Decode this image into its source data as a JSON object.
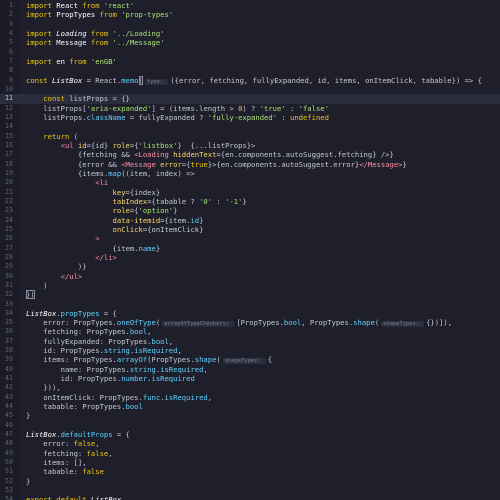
{
  "editor": {
    "active_line": 10,
    "lines": [
      {
        "n": "1",
        "tokens": [
          {
            "t": "import",
            "c": "kw"
          },
          {
            "t": " React ",
            "c": "id"
          },
          {
            "t": "from",
            "c": "kw"
          },
          {
            "t": " 'react'",
            "c": "str"
          }
        ]
      },
      {
        "n": "2",
        "tokens": [
          {
            "t": "import",
            "c": "kw"
          },
          {
            "t": " PropTypes ",
            "c": "id"
          },
          {
            "t": "from",
            "c": "kw"
          },
          {
            "t": " 'prop-types'",
            "c": "str"
          }
        ]
      },
      {
        "n": "3",
        "tokens": []
      },
      {
        "n": "4",
        "tokens": [
          {
            "t": "import",
            "c": "kw"
          },
          {
            "t": " Loading ",
            "c": "id it"
          },
          {
            "t": "from",
            "c": "kw"
          },
          {
            "t": " '../Loading'",
            "c": "str"
          }
        ]
      },
      {
        "n": "5",
        "tokens": [
          {
            "t": "import",
            "c": "kw"
          },
          {
            "t": " Message ",
            "c": "id"
          },
          {
            "t": "from",
            "c": "kw"
          },
          {
            "t": " '../Message'",
            "c": "str"
          }
        ]
      },
      {
        "n": "6",
        "tokens": []
      },
      {
        "n": "7",
        "tokens": [
          {
            "t": "import",
            "c": "kw"
          },
          {
            "t": " en ",
            "c": "id"
          },
          {
            "t": "from",
            "c": "kw"
          },
          {
            "t": " 'enGB'",
            "c": "str"
          }
        ]
      },
      {
        "n": "8",
        "tokens": []
      },
      {
        "n": "9",
        "tokens": [
          {
            "t": "const",
            "c": "kw"
          },
          {
            "t": " ListBox",
            "c": "id it"
          },
          {
            "t": " = React.",
            "c": "pun"
          },
          {
            "t": "memo",
            "c": "prop"
          },
          {
            "t": "(",
            "c": "pun cur"
          },
          {
            "t": "type: ",
            "c": "hint"
          },
          {
            "t": "({error, fetching, fullyExpanded, id, items, onItemClick, tabable}) => {",
            "c": "pun"
          }
        ]
      },
      {
        "n": "10",
        "tokens": []
      },
      {
        "n": "11",
        "tokens": [
          {
            "t": "    const",
            "c": "kw"
          },
          {
            "t": " listProps = {}",
            "c": "pun"
          }
        ]
      },
      {
        "n": "12",
        "tokens": [
          {
            "t": "    listProps[",
            "c": "pun"
          },
          {
            "t": "'aria-expanded'",
            "c": "str"
          },
          {
            "t": "] = (items.length > ",
            "c": "pun"
          },
          {
            "t": "0",
            "c": "num"
          },
          {
            "t": ") ? ",
            "c": "pun"
          },
          {
            "t": "'true'",
            "c": "str"
          },
          {
            "t": " : ",
            "c": "pun"
          },
          {
            "t": "'false'",
            "c": "str"
          }
        ]
      },
      {
        "n": "13",
        "tokens": [
          {
            "t": "    listProps.",
            "c": "pun"
          },
          {
            "t": "className",
            "c": "prop"
          },
          {
            "t": " = fullyExpanded ? ",
            "c": "pun"
          },
          {
            "t": "'fully-expanded'",
            "c": "str"
          },
          {
            "t": " : ",
            "c": "pun"
          },
          {
            "t": "undefined",
            "c": "kw"
          }
        ]
      },
      {
        "n": "14",
        "tokens": []
      },
      {
        "n": "15",
        "tokens": [
          {
            "t": "    return",
            "c": "kw"
          },
          {
            "t": " (",
            "c": "pun"
          }
        ]
      },
      {
        "n": "16",
        "tokens": [
          {
            "t": "        <ul ",
            "c": "tag"
          },
          {
            "t": "id",
            "c": "attr"
          },
          {
            "t": "={id} ",
            "c": "pun"
          },
          {
            "t": "role",
            "c": "attr"
          },
          {
            "t": "={",
            "c": "pun"
          },
          {
            "t": "'listbox'",
            "c": "str"
          },
          {
            "t": "}  {...listProps}>",
            "c": "pun"
          }
        ]
      },
      {
        "n": "17",
        "tokens": [
          {
            "t": "            {fetching && ",
            "c": "pun"
          },
          {
            "t": "<Loading ",
            "c": "tag"
          },
          {
            "t": "hiddenText",
            "c": "attr"
          },
          {
            "t": "={en.components.autoSuggest.fetching} />}",
            "c": "pun"
          }
        ]
      },
      {
        "n": "18",
        "tokens": [
          {
            "t": "            {error && ",
            "c": "pun"
          },
          {
            "t": "<Message ",
            "c": "tag"
          },
          {
            "t": "error",
            "c": "attr"
          },
          {
            "t": "={",
            "c": "pun"
          },
          {
            "t": "true",
            "c": "kw"
          },
          {
            "t": "}>{en.components.autoSuggest.error}",
            "c": "pun"
          },
          {
            "t": "</Message>",
            "c": "tag"
          },
          {
            "t": "}",
            "c": "pun"
          }
        ]
      },
      {
        "n": "19",
        "tokens": [
          {
            "t": "            {items.",
            "c": "pun"
          },
          {
            "t": "map",
            "c": "prop"
          },
          {
            "t": "((item, index) =>",
            "c": "pun"
          }
        ]
      },
      {
        "n": "20",
        "tokens": [
          {
            "t": "                <li",
            "c": "tag"
          }
        ]
      },
      {
        "n": "21",
        "tokens": [
          {
            "t": "                    key",
            "c": "attr"
          },
          {
            "t": "={index}",
            "c": "pun"
          }
        ]
      },
      {
        "n": "22",
        "tokens": [
          {
            "t": "                    tabIndex",
            "c": "attr"
          },
          {
            "t": "={tabable ? ",
            "c": "pun"
          },
          {
            "t": "'0'",
            "c": "str"
          },
          {
            "t": " : ",
            "c": "pun"
          },
          {
            "t": "'-1'",
            "c": "str"
          },
          {
            "t": "}",
            "c": "pun"
          }
        ]
      },
      {
        "n": "23",
        "tokens": [
          {
            "t": "                    role",
            "c": "attr"
          },
          {
            "t": "={",
            "c": "pun"
          },
          {
            "t": "'option'",
            "c": "str"
          },
          {
            "t": "}",
            "c": "pun"
          }
        ]
      },
      {
        "n": "24",
        "tokens": [
          {
            "t": "                    data-itemid",
            "c": "attr"
          },
          {
            "t": "={item.",
            "c": "pun"
          },
          {
            "t": "id",
            "c": "prop"
          },
          {
            "t": "}",
            "c": "pun"
          }
        ]
      },
      {
        "n": "25",
        "tokens": [
          {
            "t": "                    onClick",
            "c": "attr"
          },
          {
            "t": "={onItemClick}",
            "c": "pun"
          }
        ]
      },
      {
        "n": "26",
        "tokens": [
          {
            "t": "                >",
            "c": "tag"
          }
        ]
      },
      {
        "n": "27",
        "tokens": [
          {
            "t": "                    {item.",
            "c": "pun"
          },
          {
            "t": "name",
            "c": "prop"
          },
          {
            "t": "}",
            "c": "pun"
          }
        ]
      },
      {
        "n": "28",
        "tokens": [
          {
            "t": "                ",
            "c": "pun"
          },
          {
            "t": "</li>",
            "c": "tag"
          }
        ]
      },
      {
        "n": "29",
        "tokens": [
          {
            "t": "            )}",
            "c": "pun"
          }
        ]
      },
      {
        "n": "30",
        "tokens": [
          {
            "t": "        ",
            "c": "pun"
          },
          {
            "t": "</ul>",
            "c": "tag"
          }
        ]
      },
      {
        "n": "31",
        "tokens": [
          {
            "t": "    )",
            "c": "pun"
          }
        ]
      },
      {
        "n": "32",
        "tokens": [
          {
            "t": "})",
            "c": "pun cur"
          }
        ]
      },
      {
        "n": "33",
        "tokens": []
      },
      {
        "n": "34",
        "tokens": [
          {
            "t": "ListBox",
            "c": "id it"
          },
          {
            "t": ".",
            "c": "pun"
          },
          {
            "t": "propTypes",
            "c": "prop"
          },
          {
            "t": " = {",
            "c": "pun"
          }
        ]
      },
      {
        "n": "35",
        "tokens": [
          {
            "t": "    error: PropTypes.",
            "c": "pun"
          },
          {
            "t": "oneOfType",
            "c": "prop"
          },
          {
            "t": "(",
            "c": "pun"
          },
          {
            "t": "arrayOfTypeCheckers: ",
            "c": "hint"
          },
          {
            "t": "[PropTypes.",
            "c": "pun"
          },
          {
            "t": "bool",
            "c": "prop"
          },
          {
            "t": ", PropTypes.",
            "c": "pun"
          },
          {
            "t": "shape",
            "c": "prop"
          },
          {
            "t": "(",
            "c": "pun"
          },
          {
            "t": "shapeTypes: ",
            "c": "hint"
          },
          {
            "t": "{})]),",
            "c": "pun"
          }
        ]
      },
      {
        "n": "36",
        "tokens": [
          {
            "t": "    fetching: PropTypes.",
            "c": "pun"
          },
          {
            "t": "bool",
            "c": "prop"
          },
          {
            "t": ",",
            "c": "pun"
          }
        ]
      },
      {
        "n": "37",
        "tokens": [
          {
            "t": "    fullyExpanded: PropTypes.",
            "c": "pun"
          },
          {
            "t": "bool",
            "c": "prop"
          },
          {
            "t": ",",
            "c": "pun"
          }
        ]
      },
      {
        "n": "38",
        "tokens": [
          {
            "t": "    id: PropTypes.",
            "c": "pun"
          },
          {
            "t": "string",
            "c": "prop"
          },
          {
            "t": ".",
            "c": "pun"
          },
          {
            "t": "isRequired",
            "c": "prop"
          },
          {
            "t": ",",
            "c": "pun"
          }
        ]
      },
      {
        "n": "39",
        "tokens": [
          {
            "t": "    items: PropTypes.",
            "c": "pun"
          },
          {
            "t": "arrayOf",
            "c": "prop"
          },
          {
            "t": "(PropTypes.",
            "c": "pun"
          },
          {
            "t": "shape",
            "c": "prop"
          },
          {
            "t": "(",
            "c": "pun"
          },
          {
            "t": "shapeTypes: ",
            "c": "hint"
          },
          {
            "t": "{",
            "c": "pun"
          }
        ]
      },
      {
        "n": "40",
        "tokens": [
          {
            "t": "        name: PropTypes.",
            "c": "pun"
          },
          {
            "t": "string",
            "c": "prop"
          },
          {
            "t": ".",
            "c": "pun"
          },
          {
            "t": "isRequired",
            "c": "prop"
          },
          {
            "t": ",",
            "c": "pun"
          }
        ]
      },
      {
        "n": "41",
        "tokens": [
          {
            "t": "        id: PropTypes.",
            "c": "pun"
          },
          {
            "t": "number",
            "c": "prop"
          },
          {
            "t": ".",
            "c": "pun"
          },
          {
            "t": "isRequired",
            "c": "prop"
          }
        ]
      },
      {
        "n": "42",
        "tokens": [
          {
            "t": "    })),",
            "c": "pun"
          }
        ]
      },
      {
        "n": "43",
        "tokens": [
          {
            "t": "    onItemClick: PropTypes.",
            "c": "pun"
          },
          {
            "t": "func",
            "c": "prop"
          },
          {
            "t": ".",
            "c": "pun"
          },
          {
            "t": "isRequired",
            "c": "prop"
          },
          {
            "t": ",",
            "c": "pun"
          }
        ]
      },
      {
        "n": "44",
        "tokens": [
          {
            "t": "    tabable: PropTypes.",
            "c": "pun"
          },
          {
            "t": "bool",
            "c": "prop"
          }
        ]
      },
      {
        "n": "45",
        "tokens": [
          {
            "t": "}",
            "c": "pun"
          }
        ]
      },
      {
        "n": "46",
        "tokens": []
      },
      {
        "n": "47",
        "tokens": [
          {
            "t": "ListBox",
            "c": "id it"
          },
          {
            "t": ".",
            "c": "pun"
          },
          {
            "t": "defaultProps",
            "c": "prop"
          },
          {
            "t": " = {",
            "c": "pun"
          }
        ]
      },
      {
        "n": "48",
        "tokens": [
          {
            "t": "    error: ",
            "c": "pun"
          },
          {
            "t": "false",
            "c": "kw"
          },
          {
            "t": ",",
            "c": "pun"
          }
        ]
      },
      {
        "n": "49",
        "tokens": [
          {
            "t": "    fetching: ",
            "c": "pun"
          },
          {
            "t": "false",
            "c": "kw"
          },
          {
            "t": ",",
            "c": "pun"
          }
        ]
      },
      {
        "n": "50",
        "tokens": [
          {
            "t": "    items: [],",
            "c": "pun"
          }
        ]
      },
      {
        "n": "51",
        "tokens": [
          {
            "t": "    tabable: ",
            "c": "pun"
          },
          {
            "t": "false",
            "c": "kw"
          }
        ]
      },
      {
        "n": "52",
        "tokens": [
          {
            "t": "}",
            "c": "pun"
          }
        ]
      },
      {
        "n": "53",
        "tokens": []
      },
      {
        "n": "54",
        "tokens": [
          {
            "t": "export default",
            "c": "kw"
          },
          {
            "t": " ListBox",
            "c": "id it"
          }
        ]
      }
    ]
  },
  "colors": {
    "background": "#1e1f2b",
    "keyword": "#f1c40f",
    "string": "#a7e36e",
    "property": "#5fd4ff",
    "tag": "#ff8fa3",
    "attribute": "#ffd866",
    "line_highlight": "#2a2d3d"
  }
}
